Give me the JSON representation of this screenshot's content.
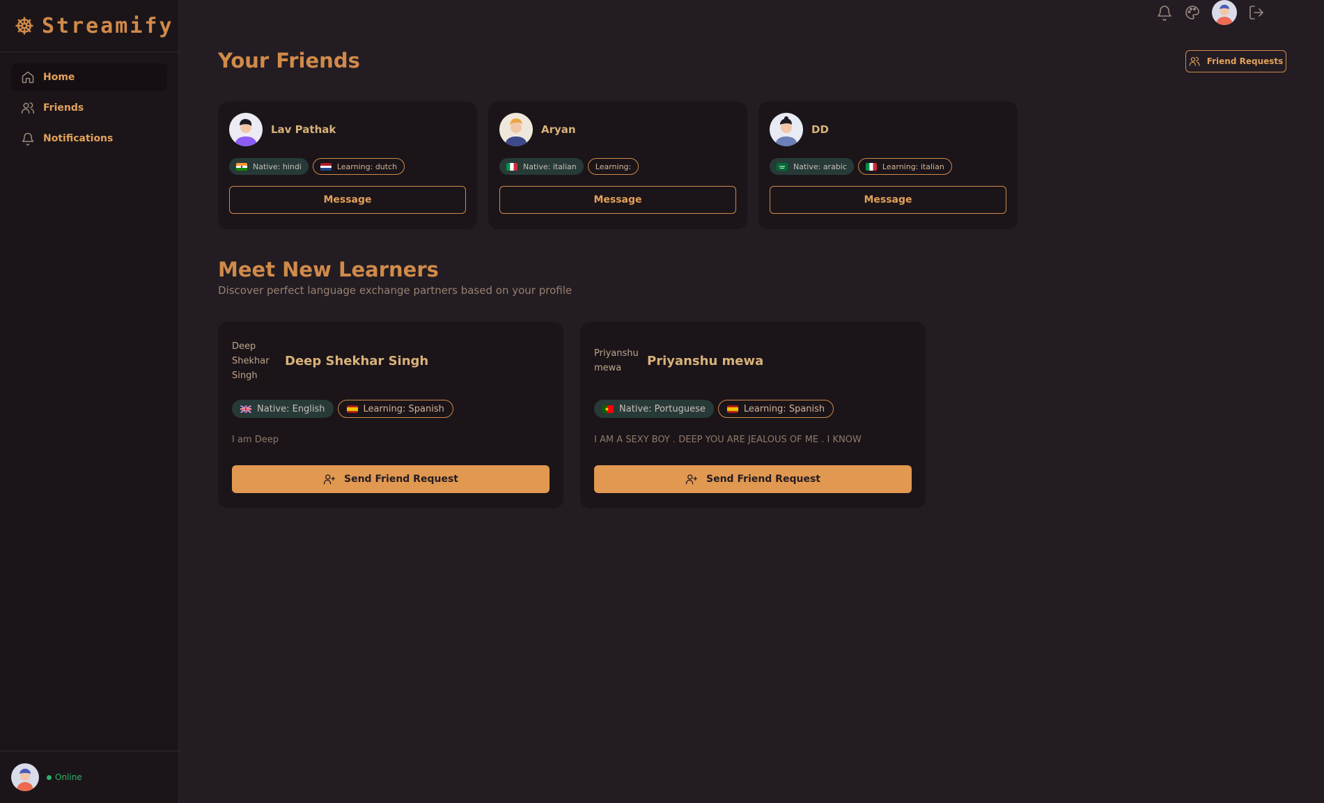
{
  "brand": {
    "name": "Streamify",
    "icon": "ship-wheel-icon"
  },
  "sidebar": {
    "items": [
      {
        "label": "Home",
        "icon": "home-icon",
        "active": true
      },
      {
        "label": "Friends",
        "icon": "users-icon",
        "active": false
      },
      {
        "label": "Notifications",
        "icon": "bell-icon",
        "active": false
      }
    ],
    "status": "Online"
  },
  "topbar": {
    "icons": [
      "bell-icon",
      "palette-icon",
      "avatar",
      "logout-icon"
    ]
  },
  "friends_section": {
    "title": "Your Friends",
    "friend_requests_label": "Friend Requests",
    "friends": [
      {
        "name": "Lav Pathak",
        "native": "Native: hindi",
        "native_flag": "india",
        "learning": "Learning: dutch",
        "learning_flag": "netherlands",
        "button": "Message"
      },
      {
        "name": "Aryan",
        "native": "Native: italian",
        "native_flag": "italy",
        "learning": "Learning:",
        "learning_flag": "",
        "button": "Message"
      },
      {
        "name": "DD",
        "native": "Native: arabic",
        "native_flag": "saudi-arabia",
        "learning": "Learning: italian",
        "learning_flag": "italy",
        "button": "Message"
      }
    ]
  },
  "learners_section": {
    "title": "Meet New Learners",
    "subtitle": "Discover perfect language exchange partners based on your profile",
    "learners": [
      {
        "alt": "Deep Shekhar Singh",
        "name": "Deep Shekhar Singh",
        "native": "Native: English",
        "native_flag": "uk",
        "learning": "Learning: Spanish",
        "learning_flag": "spain",
        "bio": "I am Deep",
        "button": "Send Friend Request"
      },
      {
        "alt": "Priyanshu mewa",
        "name": "Priyanshu mewa",
        "native": "Native: Portuguese",
        "native_flag": "portugal",
        "learning": "Learning: Spanish",
        "learning_flag": "spain",
        "bio": "I AM A SEXY BOY . DEEP YOU ARE JEALOUS OF ME . I KNOW",
        "button": "Send Friend Request"
      }
    ]
  },
  "colors": {
    "background": "#231c22",
    "accent": "#e19850",
    "card": "#1b1519",
    "native_badge": "#273a38"
  }
}
